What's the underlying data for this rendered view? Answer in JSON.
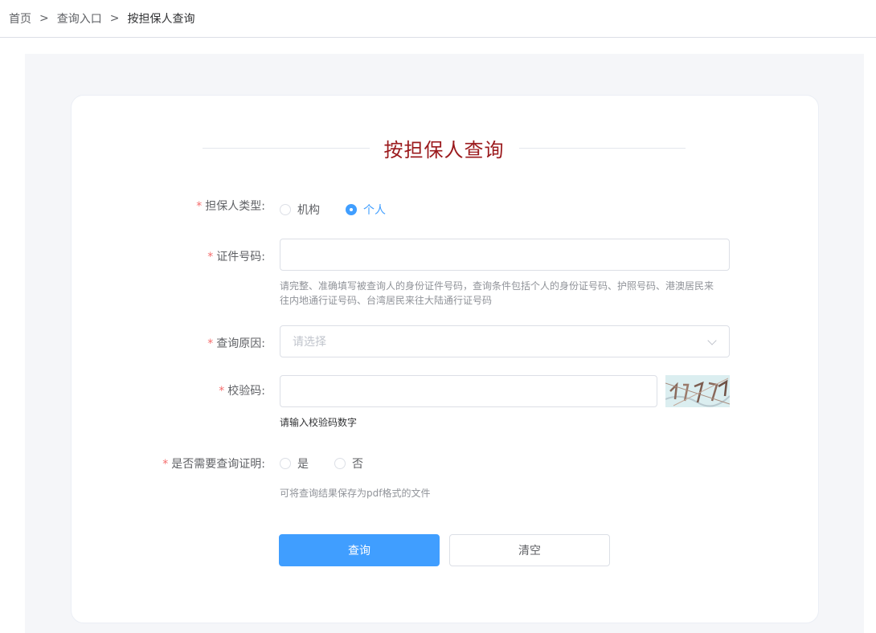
{
  "breadcrumb": {
    "items": [
      "首页",
      "查询入口",
      "按担保人查询"
    ],
    "separator": ">"
  },
  "form": {
    "title": "按担保人查询",
    "guarantor_type": {
      "label": "担保人类型:",
      "options": [
        {
          "label": "机构",
          "checked": false
        },
        {
          "label": "个人",
          "checked": true
        }
      ]
    },
    "id_number": {
      "label": "证件号码:",
      "value": "",
      "hint_line1": "请完整、准确填写被查询人的身份证件号码，查询条件包括个人的身份证号码、护照号码、港澳居民来",
      "hint_line2": "往内地通行证号码、台湾居民来往大陆通行证号码"
    },
    "reason": {
      "label": "查询原因:",
      "placeholder": "请选择"
    },
    "captcha": {
      "label": "校验码:",
      "value": "",
      "hint": "请输入校验码数字"
    },
    "certificate": {
      "label": "是否需要查询证明:",
      "options": [
        {
          "label": "是",
          "checked": false
        },
        {
          "label": "否",
          "checked": false
        }
      ],
      "hint": "可将查询结果保存为pdf格式的文件"
    },
    "buttons": {
      "query": "查询",
      "clear": "清空"
    },
    "required_mark": "*"
  },
  "colors": {
    "title": "#9b1a1d",
    "primary": "#409eff",
    "required": "#f56c6c"
  }
}
